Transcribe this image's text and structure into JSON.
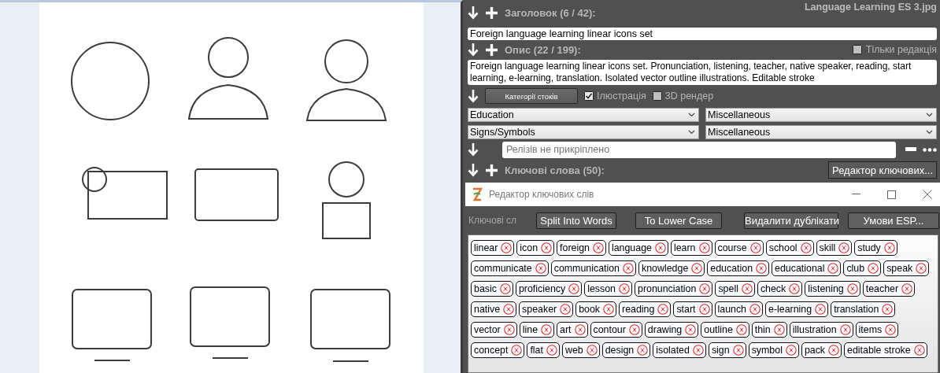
{
  "file_name": "Language Learning ES 3.jpg",
  "title_section": {
    "label": "Заголовок (6 / 42):",
    "value": "Foreign language learning linear icons set"
  },
  "description_section": {
    "label": "Опис (22 / 199):",
    "value": "Foreign language learning linear icons set. Pronunciation, listening, teacher, native speaker, reading, start learning, e-learning, translation. Isolated vector outline illustrations. Editable stroke",
    "editorial_only": {
      "label": "Тільки редакція",
      "checked": false
    }
  },
  "categories": {
    "button": "Категорії стоків",
    "options": [
      {
        "label": "Ілюстрація",
        "checked": true
      },
      {
        "label": "3D рендер",
        "checked": false
      }
    ],
    "dropdowns": [
      [
        "Education",
        "Miscellaneous"
      ],
      [
        "Signs/Symbols",
        "Miscellaneous"
      ]
    ]
  },
  "releases": {
    "placeholder": "Релізів не прикріплено"
  },
  "keywords_section": {
    "label": "Ключові слова (50):",
    "editor_button": "Редактор ключових..."
  },
  "keyword_editor": {
    "title": "Редактор ключових слів",
    "label": "Ключові сл",
    "buttons": [
      "Split Into Words",
      "To Lower Case",
      "Видалити дублікати",
      "Умови ESP..."
    ],
    "keyword_rows": [
      [
        "linear",
        "icon",
        "foreign",
        "language",
        "learn",
        "course",
        "school",
        "skill",
        "study"
      ],
      [
        "communicate",
        "communication",
        "knowledge",
        "education",
        "educational",
        "club",
        "speak"
      ],
      [
        "basic",
        "proficiency",
        "lesson",
        "pronunciation",
        "spell",
        "check",
        "listening",
        "teacher"
      ],
      [
        "native",
        "speaker",
        "book",
        "reading",
        "start",
        "launch",
        "e-learning",
        "translation"
      ],
      [
        "vector",
        "line",
        "art",
        "contour",
        "drawing",
        "outline",
        "thin",
        "illustration",
        "items"
      ],
      [
        "concept",
        "flat",
        "web",
        "design",
        "isolated",
        "sign",
        "symbol",
        "pack",
        "editable stroke"
      ]
    ]
  }
}
